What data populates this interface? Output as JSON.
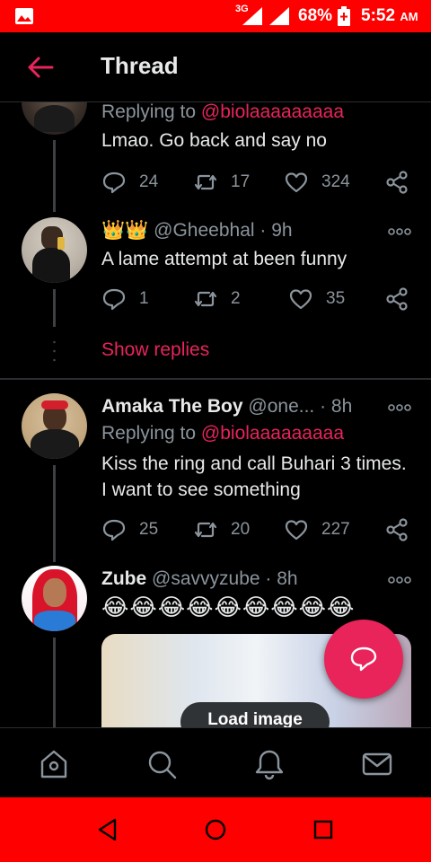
{
  "status_bar": {
    "network": "3G",
    "battery_percent": "68%",
    "time": "5:52",
    "ampm": "AM"
  },
  "header": {
    "title": "Thread"
  },
  "tweets": [
    {
      "replying_label": "Replying to",
      "replying_handle": "@biolaaaaaaaaa",
      "text": "Lmao. Go back and say no",
      "replies": "24",
      "retweets": "17",
      "likes": "324"
    },
    {
      "display_name": "👑👑",
      "handle": "@Gheebhal",
      "time": "· 9h",
      "text": "A lame attempt at been funny",
      "replies": "1",
      "retweets": "2",
      "likes": "35"
    },
    {
      "display_name": "Amaka The Boy",
      "handle": "@one...",
      "time": "· 8h",
      "replying_label": "Replying to",
      "replying_handle": "@biolaaaaaaaaa",
      "text": "Kiss the ring and call Buhari 3 times. I want to see something",
      "replies": "25",
      "retweets": "20",
      "likes": "227"
    },
    {
      "display_name": "Zube",
      "handle": "@savvyzube",
      "time": "· 8h",
      "text": "😂😂😂😂😂😂😂😂😂"
    }
  ],
  "show_replies": "Show replies",
  "load_image": "Load image",
  "colors": {
    "accent": "#e8245b",
    "status_bar": "#ff0000",
    "background": "#000000",
    "muted_text": "#8b949c"
  },
  "icons": {
    "back": "arrow-left-icon",
    "reply": "speech-bubble-icon",
    "retweet": "retweet-icon",
    "like": "heart-icon",
    "share": "share-icon",
    "more": "more-dots-icon",
    "compose": "compose-reply-icon",
    "nav": [
      "home-icon",
      "search-icon",
      "notifications-icon",
      "messages-icon"
    ]
  }
}
